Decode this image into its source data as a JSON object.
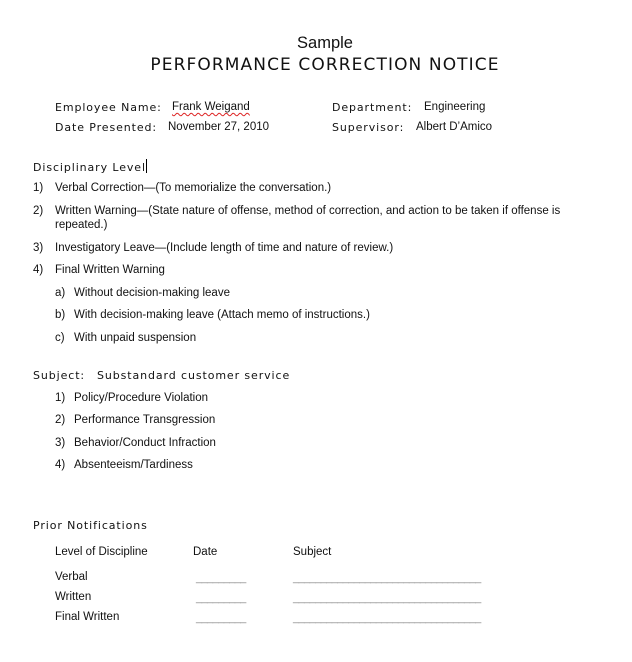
{
  "document": {
    "sample_label": "Sample",
    "title": "PERFORMANCE CORRECTION NOTICE"
  },
  "info": {
    "employee_name_label": "Employee Name:",
    "employee_name": "Frank Weigand",
    "date_presented_label": "Date Presented:",
    "date_presented": "November 27, 2010",
    "department_label": "Department:",
    "department": "Engineering",
    "supervisor_label": "Supervisor:",
    "supervisor": "Albert D’Amico"
  },
  "disciplinary": {
    "heading": "Disciplinary Level",
    "items": [
      {
        "num": "1)",
        "text": "Verbal Correction—(To memorialize the conversation.)"
      },
      {
        "num": "2)",
        "text": "Written Warning—(State nature of offense, method of correction, and action to be taken if offense is",
        "text2": "repeated.)"
      },
      {
        "num": "3)",
        "text": "Investigatory Leave—(Include length of time and nature of review.)"
      },
      {
        "num": "4)",
        "text": "Final Written Warning"
      }
    ],
    "subitems": [
      {
        "num": "a)",
        "text": "Without decision-making leave"
      },
      {
        "num": "b)",
        "text": "With decision-making leave (Attach memo of instructions.)"
      },
      {
        "num": "c)",
        "text": "With unpaid suspension"
      }
    ]
  },
  "subject": {
    "label": "Subject:",
    "value": "Substandard customer service",
    "items": [
      {
        "num": "1)",
        "text": "Policy/Procedure Violation"
      },
      {
        "num": "2)",
        "text": "Performance Transgression"
      },
      {
        "num": "3)",
        "text": "Behavior/Conduct Infraction"
      },
      {
        "num": "4)",
        "text": "Absenteeism/Tardiness"
      }
    ]
  },
  "prior": {
    "heading": "Prior Notifications",
    "columns": [
      "Level of Discipline",
      "Date",
      "Subject"
    ],
    "rows": [
      {
        "level": "Verbal",
        "date": "_________",
        "subject": "__________________________________"
      },
      {
        "level": "Written",
        "date": "_________",
        "subject": "__________________________________"
      },
      {
        "level": "Final Written",
        "date": "_________",
        "subject": "__________________________________"
      }
    ]
  }
}
